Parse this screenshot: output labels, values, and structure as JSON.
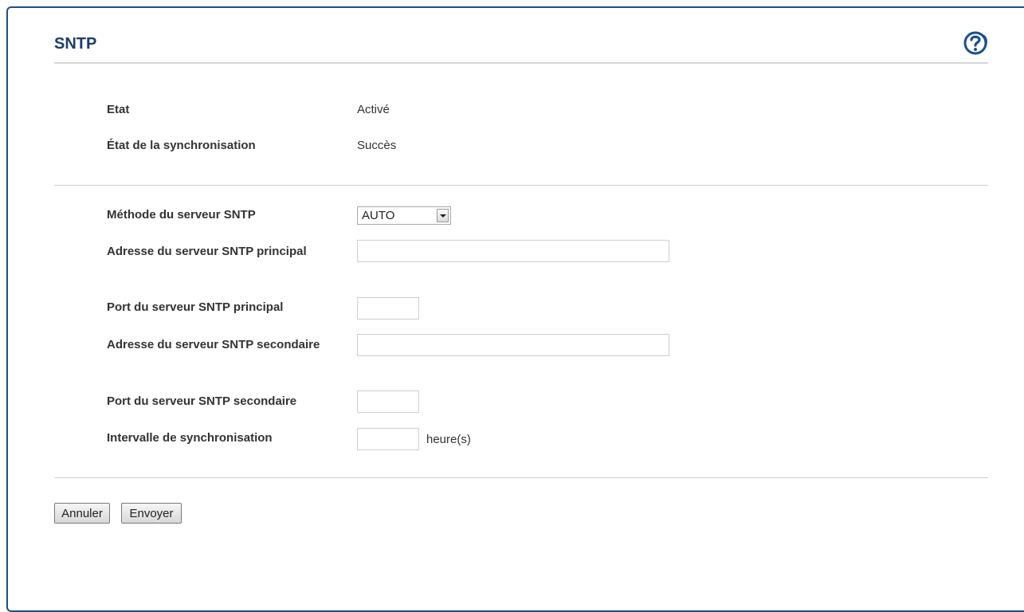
{
  "page": {
    "title": "SNTP"
  },
  "help_icon": "help-question-icon",
  "status": {
    "state_label": "Etat",
    "state_value": "Activé",
    "sync_label": "État de la synchronisation",
    "sync_value": "Succès"
  },
  "form": {
    "method_label": "Méthode du serveur SNTP",
    "method_value": "AUTO",
    "primary_address_label": "Adresse du serveur SNTP principal",
    "primary_address_value": "",
    "primary_port_label": "Port du serveur SNTP principal",
    "primary_port_value": "",
    "secondary_address_label": "Adresse du serveur SNTP secondaire",
    "secondary_address_value": "",
    "secondary_port_label": "Port du serveur SNTP secondaire",
    "secondary_port_value": "",
    "interval_label": "Intervalle de synchronisation",
    "interval_value": "",
    "interval_unit": "heure(s)"
  },
  "buttons": {
    "cancel": "Annuler",
    "submit": "Envoyer"
  },
  "colors": {
    "title": "#1c3d6a",
    "frame": "#1f4e85",
    "help_icon": "#1a4f8f"
  }
}
